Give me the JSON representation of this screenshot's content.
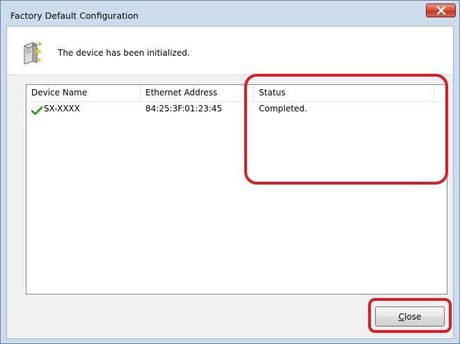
{
  "window": {
    "title": "Factory Default Configuration",
    "close_icon": "close-x-icon"
  },
  "banner": {
    "icon": "device-sparkle-icon",
    "message": "The device has been initialized."
  },
  "list": {
    "columns": [
      "Device Name",
      "Ethernet Address",
      "Status"
    ],
    "rows": [
      {
        "status_icon": "green-check-icon",
        "device_name": "SX-XXXX",
        "ethernet_address": "84:25:3F:01:23:45",
        "status": "Completed."
      }
    ]
  },
  "buttons": {
    "close_label": "Close",
    "close_mnemonic": "C",
    "close_rest": "lose"
  },
  "colors": {
    "highlight": "#e21b23",
    "check_green": "#3a9a2a",
    "titlebar_bg": "#cddcec"
  }
}
